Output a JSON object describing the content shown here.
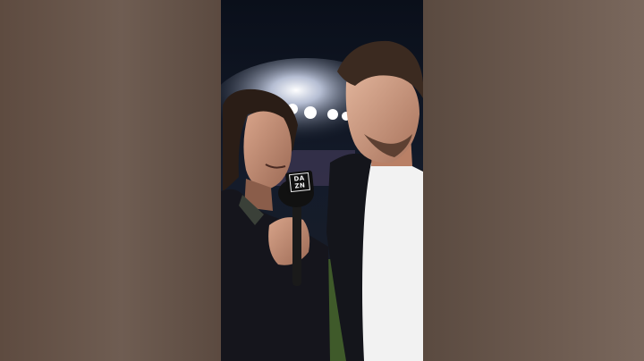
{
  "image": {
    "description_words": [],
    "mic_logo_lines": [
      "DA",
      "ZN"
    ]
  },
  "colors": {
    "side_panel": "#6a584c",
    "stadium_sky": "#0c1320",
    "white_shirt": "#f2f2f2",
    "dark_jacket": "#15151c"
  },
  "icons": {
    "mic": "microphone-icon"
  }
}
